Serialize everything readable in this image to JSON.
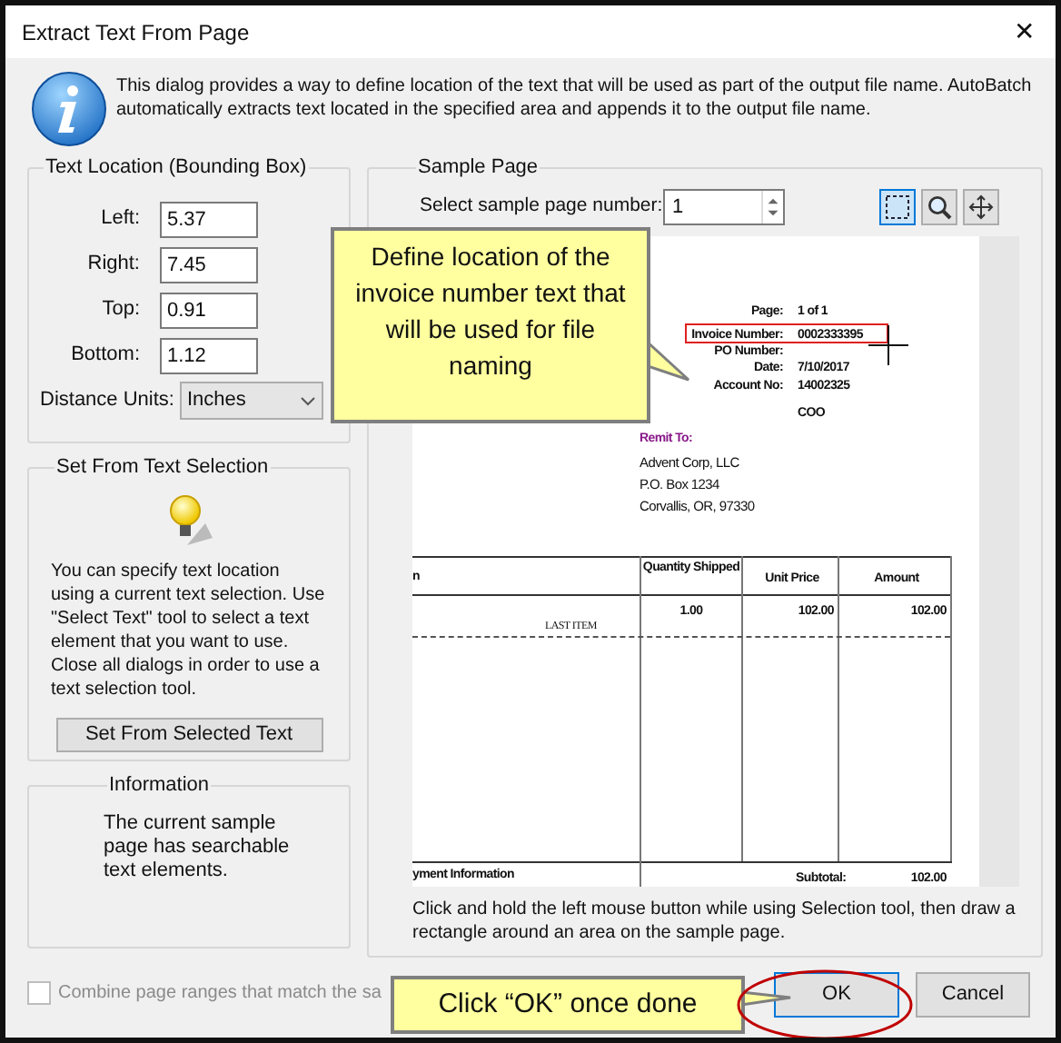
{
  "window": {
    "title": "Extract Text From Page",
    "close": "✕"
  },
  "intro": "This dialog provides a way to define location of the text that will be used as part of the output file name. AutoBatch automatically extracts text located in the specified area and appends it to the output file name.",
  "text_location": {
    "title": "Text Location (Bounding Box)",
    "fields": [
      {
        "label": "Left:",
        "value": "5.37"
      },
      {
        "label": "Right:",
        "value": "7.45"
      },
      {
        "label": "Top:",
        "value": "0.91"
      },
      {
        "label": "Bottom:",
        "value": "1.12"
      }
    ],
    "units": {
      "label": "Distance Units:",
      "value": "Inches"
    }
  },
  "text_selection": {
    "title": "Set From Text Selection",
    "description": "You can specify text location using a current text selection.  Use \"Select Text\" tool to select a text element that you want to use. Close all dialogs in order to use a text selection tool.",
    "button": "Set From Selected Text"
  },
  "information": {
    "title": "Information",
    "text": "The current sample page has searchable text elements."
  },
  "combine": {
    "label": "Combine page ranges that match the sa",
    "checked": false
  },
  "sample_page": {
    "title": "Sample Page",
    "page_number": {
      "label": "Select sample page number:",
      "value": "1"
    },
    "tools": [
      {
        "kind": "select",
        "selected": true
      },
      {
        "kind": "zoom",
        "selected": false
      },
      {
        "kind": "pan",
        "selected": false
      }
    ],
    "document": {
      "page_label": "Page:",
      "page_value": "1  of  1",
      "fields": [
        {
          "label": "Invoice Number:",
          "value": "0002333395",
          "highlighted": true
        },
        {
          "label": "PO Number:",
          "highlighted": false
        },
        {
          "label": "Date:",
          "value": "7/10/2017",
          "highlighted": false
        },
        {
          "label": "Account No:",
          "value": "14002325",
          "highlighted": false
        }
      ],
      "terms": "COO",
      "remit_title": "Remit To:",
      "remit_lines": [
        "Advent Corp, LLC",
        "P.O. Box 1234",
        "Corvallis, OR, 97330"
      ],
      "columns": [
        "n",
        "Quantity Shipped",
        "Unit Price",
        "Amount"
      ],
      "row": {
        "item": "LAST ITEM",
        "quantity": "1.00",
        "unit_price": "102.00",
        "amount": "102.00"
      },
      "footer_label": "yment Information",
      "subtotal_label": "Subtotal:",
      "subtotal": "102.00"
    },
    "hint": "Click and hold the left mouse button while using Selection tool, then draw a rectangle around an area on the sample page."
  },
  "buttons": [
    {
      "label": "OK",
      "default": true
    },
    {
      "label": "Cancel",
      "default": false
    }
  ],
  "callouts": [
    {
      "text": "Define location of the invoice number text that will be used for file naming"
    },
    {
      "text": "Click “OK” once done"
    }
  ]
}
